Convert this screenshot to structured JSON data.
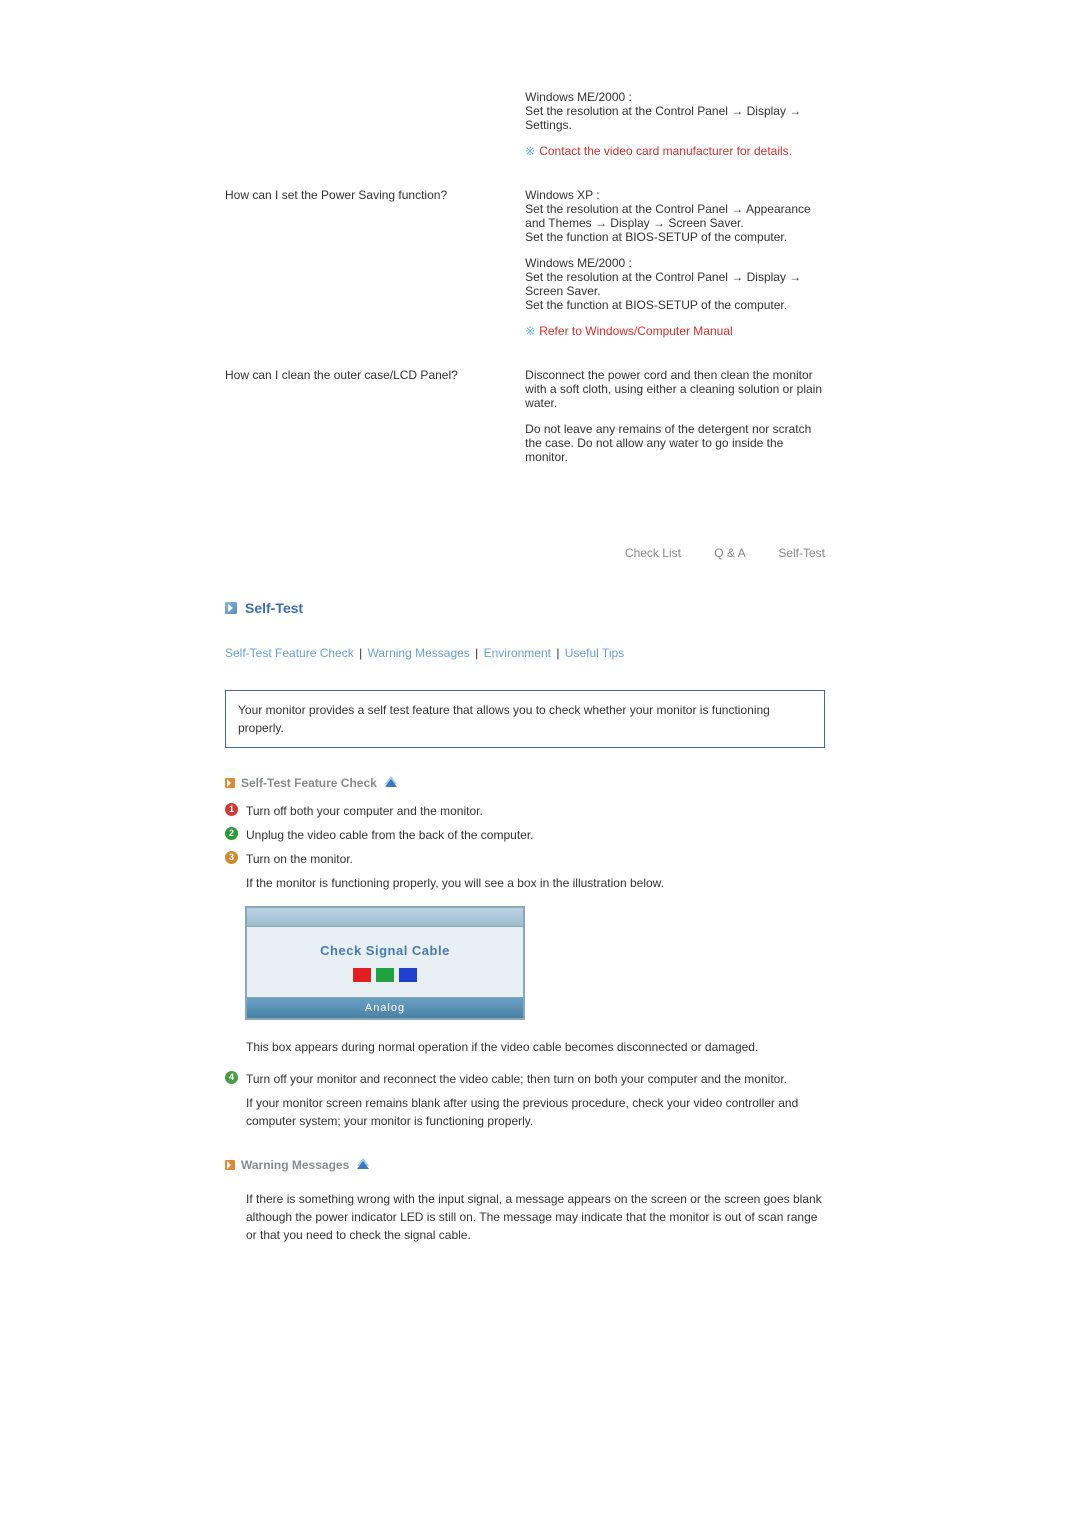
{
  "qa": {
    "prev_answer": {
      "paragraphs": [
        "Windows ME/2000 :\nSet the resolution at the Control Panel → Display → Settings."
      ],
      "note": "Contact the video card manufacturer for details."
    },
    "rows": [
      {
        "question": "How can I set the Power Saving function?",
        "paragraphs": [
          "Windows XP :\nSet the resolution at the Control Panel → Appearance and Themes → Display → Screen Saver.\nSet the function at BIOS-SETUP of the computer.",
          "Windows ME/2000 :\nSet the resolution at the Control Panel → Display → Screen Saver.\nSet the function at BIOS-SETUP of the computer."
        ],
        "note": "Refer to Windows/Computer Manual"
      },
      {
        "question": "How can I clean the outer case/LCD Panel?",
        "paragraphs": [
          "Disconnect the power cord and then clean the monitor with a soft cloth, using either a cleaning solution or plain water.",
          "Do not leave any remains of the detergent nor scratch the case. Do not allow any water to go inside the monitor."
        ],
        "note": null
      }
    ]
  },
  "tabs": [
    "Check List",
    "Q & A",
    "Self-Test"
  ],
  "section": {
    "title": "Self-Test",
    "subnav": [
      "Self-Test Feature Check",
      "Warning Messages",
      "Environment",
      "Useful Tips"
    ]
  },
  "intro": "Your monitor provides a self test feature that allows you to check whether your monitor is functioning properly.",
  "selftest": {
    "title": "Self-Test Feature Check",
    "steps": {
      "s1": "Turn off both your computer and the monitor.",
      "s2": "Unplug the video cable from the back of the computer.",
      "s3": "Turn on the monitor.",
      "s3_follow": "If the monitor is functioning properly, you will see a box in the illustration below.",
      "illu_msg": "Check Signal Cable",
      "illu_footer": "Analog",
      "illu_after": "This box appears during normal operation if the video cable becomes disconnected or damaged.",
      "s4": "Turn off your monitor and reconnect the video cable; then turn on both your computer and the monitor.",
      "s4_follow": "If your monitor screen remains blank after using the previous procedure, check your video controller and computer system; your monitor is functioning properly."
    }
  },
  "warning": {
    "title": "Warning Messages",
    "text": "If there is something wrong with the input signal, a message appears on the screen or the screen goes blank although the power indicator LED is still on. The message may indicate that the monitor is out of scan range or that you need to check the signal cable."
  }
}
